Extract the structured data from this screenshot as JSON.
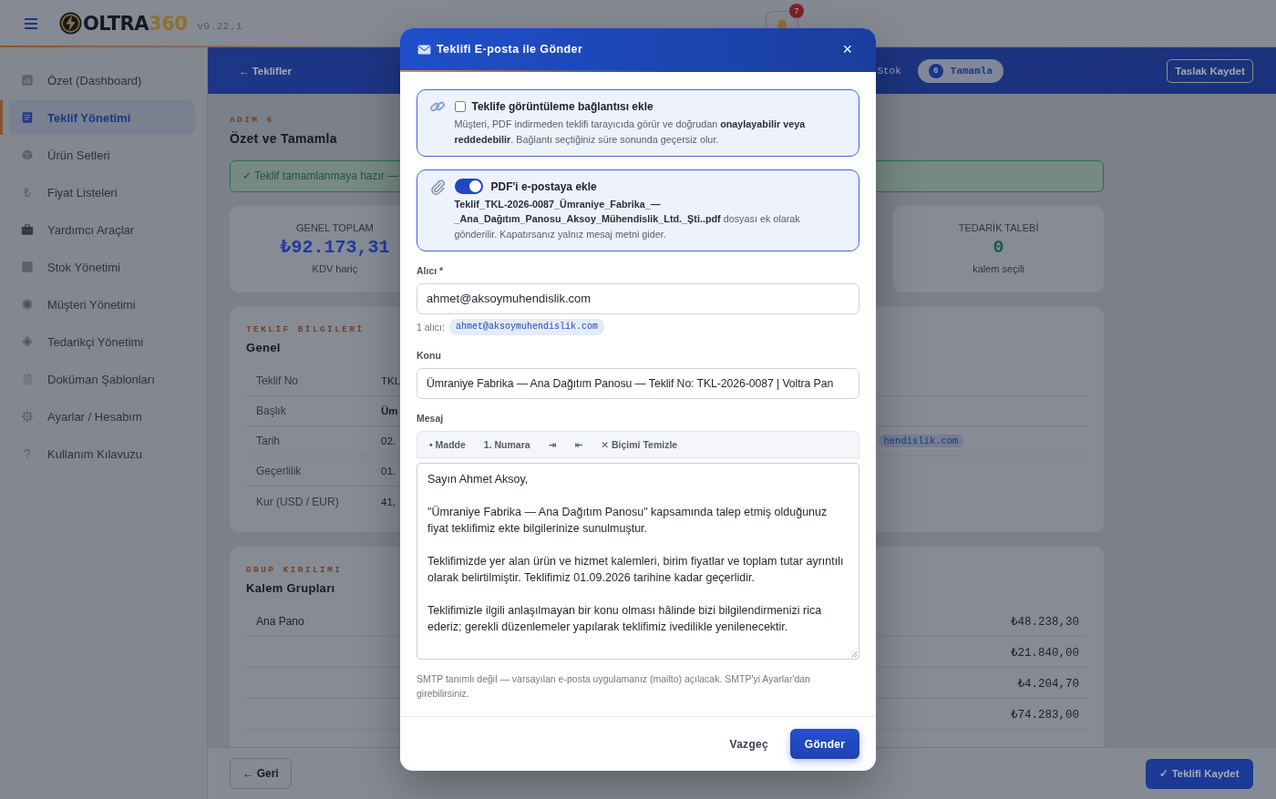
{
  "header": {
    "logo_text": "OLTRA",
    "logo_accent": "360",
    "version": "v0.22.1",
    "notification_count": "7"
  },
  "sidebar": {
    "items": [
      {
        "label": "Özet (Dashboard)",
        "selected": false
      },
      {
        "label": "Teklif Yönetimi",
        "selected": true
      },
      {
        "label": "Ürün Setleri",
        "selected": false
      },
      {
        "label": "Fiyat Listeleri",
        "glyph": "₺",
        "selected": false
      },
      {
        "label": "Yardımcı Araçlar",
        "selected": false
      },
      {
        "label": "Stok Yönetimi",
        "selected": false
      },
      {
        "label": "Müşteri Yönetimi",
        "selected": false
      },
      {
        "label": "Tedarikçi Yönetimi",
        "selected": false
      },
      {
        "label": "Doküman Şablonları",
        "selected": false
      },
      {
        "label": "Ayarlar / Hesabım",
        "selected": false
      },
      {
        "label": "Kullanım Kılavuzu",
        "glyph": "?",
        "selected": false
      }
    ]
  },
  "topbar": {
    "back_link": "← Teklifler",
    "steps": [
      {
        "label": "Stok",
        "selected": false
      },
      {
        "number": "6",
        "label": "Tamamla",
        "selected": true
      }
    ],
    "draft_button": "Taslak Kaydet"
  },
  "page": {
    "eyebrow": "ADIM 6",
    "title": "Özet ve Tamamla",
    "banner": "✓ Teklif tamamlanmaya hazır —"
  },
  "stats": [
    {
      "label": "GENEL TOPLAM",
      "value": "₺92.173,31",
      "note": "KDV hariç",
      "color": "#1f3aa0"
    },
    {
      "label": "TEDARİK TALEBİ",
      "value": "0",
      "note": "kalem seçili",
      "color": "#1a5a45"
    }
  ],
  "info": {
    "eyebrow": "TEKLİF BİLGİLERİ",
    "title": "Genel",
    "rows": [
      {
        "label": "Teklif No",
        "value": "TKL",
        "kind": "text"
      },
      {
        "label": "Başlık",
        "value": "Üm",
        "kind": "bold"
      },
      {
        "label": "Tarih",
        "value": "02.",
        "kind": "text"
      },
      {
        "label": "Geçerlilik",
        "value": "01.",
        "kind": "text"
      },
      {
        "label": "Kur (USD / EUR)",
        "value": "41,",
        "kind": "text"
      }
    ],
    "email_chip": "hendislik.com"
  },
  "groups": {
    "eyebrow": "GRUP KIRILIMI",
    "title": "Kalem Grupları",
    "rows": [
      {
        "label": "Ana Pano",
        "amount": "₺48.238,30"
      },
      {
        "amount": "₺21.840,00"
      },
      {
        "amount": "₺4.204,70"
      },
      {
        "amount": "₺74.283,00"
      }
    ]
  },
  "footer": {
    "back_button": "← Geri",
    "save_button": "✓ Teklifi Kaydet"
  },
  "modal": {
    "title": "Teklifi E-posta ile Gönder",
    "close": "×",
    "options": [
      {
        "kind": "checkbox",
        "label": "Teklife görüntüleme bağlantısı ekle",
        "checked": false,
        "description": "Müşteri, PDF indirmeden teklifi tarayıcıda görür ve doğrudan **onaylayabilir veya reddedebilir**. Bağlantı seçtiğiniz süre sonunda geçersiz olur."
      },
      {
        "kind": "toggle",
        "label": "PDF'i e-postaya ekle",
        "on": true,
        "description": "**Teklif_TKL-2026-0087_Ümraniye_Fabrika_—_Ana_Dağıtım_Panosu_Aksoy_Mühendislik_Ltd._Şti..pdf** dosyası ek olarak gönderilir. Kapatırsanız yalnız mesaj metni gider."
      }
    ],
    "recipient": {
      "label": "Alıcı *",
      "value": "ahmet@aksoymuhendislik.com",
      "count_label": "1 alıcı:",
      "chips": [
        "ahmet@aksoymuhendislik.com"
      ]
    },
    "subject": {
      "label": "Konu",
      "value": "Ümraniye Fabrika — Ana Dağıtım Panosu — Teklif No: TKL-2026-0087 | Voltra Pan"
    },
    "message": {
      "label": "Mesaj",
      "toolbar": [
        "• Madde",
        "1. Numara",
        "⇥",
        "⇤",
        "✕ Biçimi Temizle"
      ],
      "paragraphs": [
        "Sayın Ahmet Aksoy,",
        "\"Ümraniye Fabrika — Ana Dağıtım Panosu\" kapsamında talep etmiş olduğunuz fiyat teklifimiz ekte bilgilerinize sunulmuştur.",
        "Teklifimizde yer alan ürün ve hizmet kalemleri, birim fiyatlar ve toplam tutar ayrıntılı olarak belirtilmiştir. Teklifimiz 01.09.2026 tarihine kadar geçerlidir.",
        "Teklifimizle ilgili anlaşılmayan bir konu olması hâlinde bizi bilgilendirmenizi rica ederiz; gerekli düzenlemeler yapılarak teklifimiz ivedilikle yenilenecektir."
      ]
    },
    "hint": "SMTP tanımlı değil — varsayılan e-posta uygulamanız (mailto) açılacak. SMTP'yi Ayarlar'dan girebilirsiniz.",
    "buttons": {
      "cancel": "Vazgeç",
      "send": "Gönder"
    }
  }
}
